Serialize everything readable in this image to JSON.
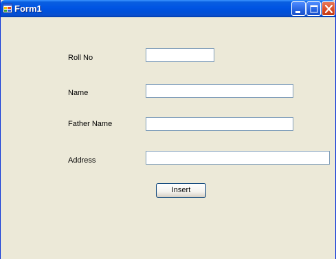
{
  "window": {
    "title": "Form1",
    "icon": "windows-form-icon",
    "controls": [
      "minimize-icon",
      "maximize-icon",
      "close-icon"
    ]
  },
  "form": {
    "roll_no": {
      "label": "Roll No",
      "value": ""
    },
    "name": {
      "label": "Name",
      "value": ""
    },
    "father_name": {
      "label": "Father Name",
      "value": ""
    },
    "address": {
      "label": "Address",
      "value": ""
    },
    "insert_button": "Insert"
  },
  "colors": {
    "titlebar": "#0054E3",
    "form_background": "#ECE9D8",
    "textbox_border": "#7F9DB9",
    "close_button": "#D84A24"
  }
}
